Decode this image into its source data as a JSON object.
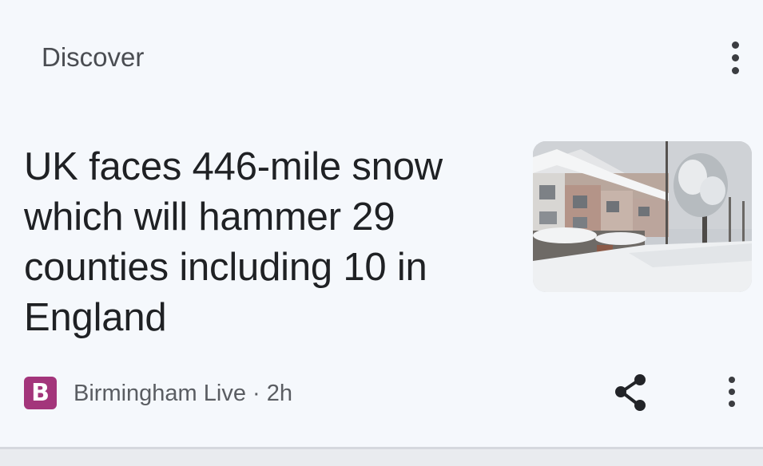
{
  "card": {
    "section_title": "Discover",
    "headline": "UK faces 446-mile snow which will hammer 29 counties including 10 in England",
    "source": {
      "logo_letter": "B",
      "name": "Birmingham Live",
      "separator": "·",
      "age": "2h"
    },
    "thumbnail": {
      "icon": "snowy-street-photo"
    },
    "colors": {
      "background": "#f5f8fc",
      "headline_text": "#1f2124",
      "source_logo": "#a3357b"
    }
  }
}
